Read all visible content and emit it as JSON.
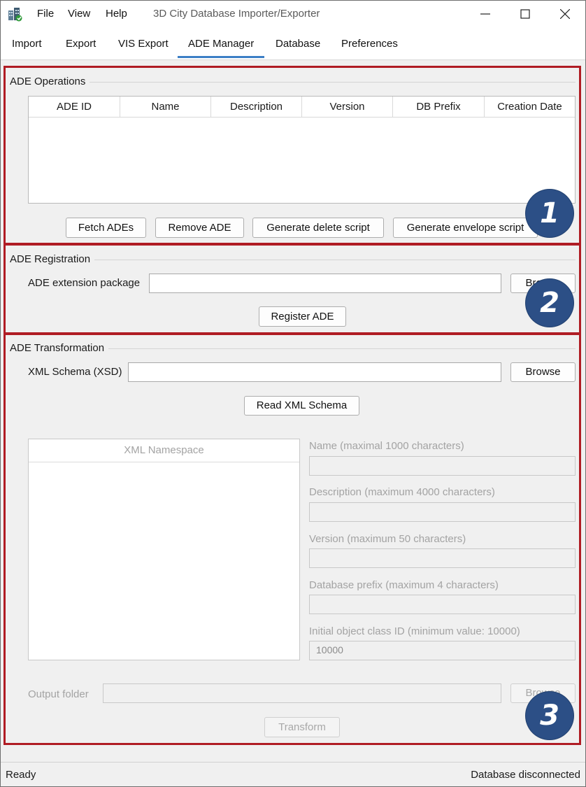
{
  "app": {
    "title": "3D City Database Importer/Exporter",
    "menu": [
      "File",
      "View",
      "Help"
    ]
  },
  "tabs": [
    "Import",
    "Export",
    "VIS Export",
    "ADE Manager",
    "Database",
    "Preferences"
  ],
  "active_tab": "ADE Manager",
  "ade_operations": {
    "title": "ADE Operations",
    "columns": [
      "ADE ID",
      "Name",
      "Description",
      "Version",
      "DB Prefix",
      "Creation Date"
    ],
    "buttons": [
      "Fetch ADEs",
      "Remove ADE",
      "Generate delete script",
      "Generate envelope script"
    ]
  },
  "ade_registration": {
    "title": "ADE Registration",
    "package_label": "ADE extension package",
    "browse_label": "Browse",
    "register_label": "Register ADE"
  },
  "ade_transformation": {
    "title": "ADE Transformation",
    "xsd_label": "XML Schema (XSD)",
    "browse_label": "Browse",
    "read_label": "Read XML Schema",
    "namespace_header": "XML Namespace",
    "fields": {
      "name_label": "Name (maximal 1000 characters)",
      "description_label": "Description (maximum 4000 characters)",
      "version_label": "Version (maximum 50 characters)",
      "prefix_label": "Database prefix (maximum 4 characters)",
      "class_id_label": "Initial object class ID (minimum value: 10000)",
      "class_id_value": "10000"
    },
    "output_label": "Output folder",
    "output_browse_label": "Browse",
    "transform_label": "Transform"
  },
  "badges": [
    "1",
    "2",
    "3"
  ],
  "status": {
    "left": "Ready",
    "right": "Database disconnected"
  },
  "colors": {
    "highlight_border": "#b01c24",
    "badge_fill": "#2c4f86",
    "tab_accent": "#3c7fc6"
  }
}
